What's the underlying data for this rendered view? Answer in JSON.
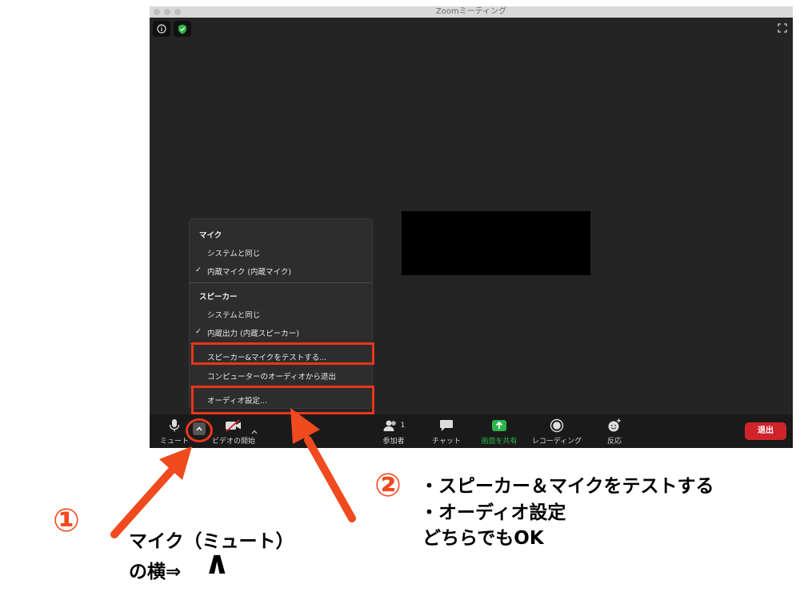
{
  "window": {
    "title": "Zoomミーティング"
  },
  "menu": {
    "mic_header": "マイク",
    "mic_options": [
      {
        "label": "システムと同じ",
        "checked": false
      },
      {
        "label": "内蔵マイク (内蔵マイク)",
        "checked": true
      }
    ],
    "speaker_header": "スピーカー",
    "speaker_options": [
      {
        "label": "システムと同じ",
        "checked": false
      },
      {
        "label": "内蔵出力 (内蔵スピーカー)",
        "checked": true
      }
    ],
    "test_label": "スピーカー&マイクをテストする...",
    "leave_audio_label": "コンピューターのオーディオから退出",
    "audio_settings_label": "オーディオ設定...",
    "check_mark": "✓"
  },
  "toolbar": {
    "mute_label": "ミュート",
    "video_label": "ビデオの開始",
    "participants_label": "参加者",
    "participants_count": "1",
    "chat_label": "チャット",
    "share_label": "画面を共有",
    "record_label": "レコーディング",
    "reactions_label": "反応",
    "leave_label": "退出"
  },
  "annotations": {
    "num1": "①",
    "num2": "②",
    "note1_line1": "マイク（ミュート）",
    "note1_line2": "の横⇒",
    "caret_symbol": "∧",
    "note2_line1": "・スピーカー＆マイクをテストする",
    "note2_line2": "・オーディオ設定",
    "note2_line3": "どちらでもOK"
  },
  "colors": {
    "accent_red": "#e8361a",
    "share_green": "#2bb44a",
    "leave_red": "#d0232a",
    "shield_green": "#2bb44a"
  }
}
